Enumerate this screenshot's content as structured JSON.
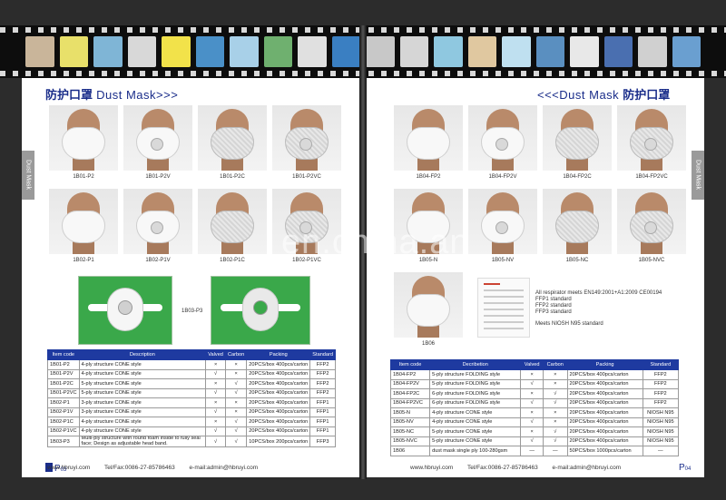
{
  "filmstrip": {
    "frame_colors": [
      "#c9b59a",
      "#e8e06a",
      "#7fb5d6",
      "#d8d8d8",
      "#f2e24a",
      "#4a90c8",
      "#a8d0e8",
      "#6fb06f",
      "#e0e0e0",
      "#3a7fc2",
      "#c8c8c8",
      "#d6d6d6",
      "#8fc8e0",
      "#e0c8a0",
      "#bfe0f0",
      "#5a8fc0",
      "#e8e8e8",
      "#4a6fb0",
      "#d0d0d0",
      "#6a9fd0"
    ]
  },
  "left_page": {
    "title_cn": "防护口罩",
    "title_en": " Dust Mask>>>",
    "side_tab": "Dust Mask",
    "row1_codes": [
      "1B01-P2",
      "1B01-P2V",
      "1B01-P2C",
      "1B01-P2VC"
    ],
    "row2_codes": [
      "1B02-P1",
      "1B02-P1V",
      "1B02-P1C",
      "1B02-P1VC"
    ],
    "wide_label": "1B03-P3",
    "table": {
      "headers": [
        "Item code",
        "Description",
        "Valved",
        "Carbon",
        "Packing",
        "Standard"
      ],
      "rows": [
        [
          "1B01-P2",
          "4-ply structure  CONE style",
          "×",
          "×",
          "20PCS/box 400pcs/carton",
          "FFP2"
        ],
        [
          "1B01-P2V",
          "4-ply structure  CONE style",
          "√",
          "×",
          "20PCS/box 400pcs/carton",
          "FFP2"
        ],
        [
          "1B01-P2C",
          "5-ply structure  CONE style",
          "×",
          "√",
          "20PCS/box 400pcs/carton",
          "FFP2"
        ],
        [
          "1B01-P2VC",
          "5-ply structure  CONE style",
          "√",
          "√",
          "20PCS/box 400pcs/carton",
          "FFP2"
        ],
        [
          "1B02-P1",
          "3-ply structure  CONE style",
          "×",
          "×",
          "20PCS/box 400pcs/carton",
          "FFP1"
        ],
        [
          "1B02-P1V",
          "3-ply structure  CONE style",
          "√",
          "×",
          "20PCS/box 400pcs/carton",
          "FFP1"
        ],
        [
          "1B02-P1C",
          "4-ply structure  CONE style",
          "×",
          "√",
          "20PCS/box 400pcs/carton",
          "FFP1"
        ],
        [
          "1B02-P1VC",
          "4-ply structure  CONE style",
          "√",
          "√",
          "20PCS/box 400pcs/carton",
          "FFP1"
        ],
        [
          "1B03-P3",
          "Multi-ply structure with round foam inside to fully seal face; Design as adjustable head band.",
          "√",
          "√",
          "10PCS/box 200pcs/carton",
          "FFP3"
        ]
      ]
    },
    "page_prefix": "P",
    "page_number": "03",
    "footer": {
      "web": "www.hbruyi.com",
      "tel": "Tel/Fax:0086-27-85786463",
      "email": "e-mail:admin@hbruyi.com"
    }
  },
  "right_page": {
    "title_en": "<<<Dust Mask ",
    "title_cn": "防护口罩",
    "side_tab": "Dust Mask",
    "row1_codes": [
      "1B04-FP2",
      "1B04-FP2V",
      "1B04-FP2C",
      "1B04-FP2VC"
    ],
    "row2_codes": [
      "1B05-N",
      "1B05-NV",
      "1B05-NC",
      "1B05-NVC"
    ],
    "single_code": "1B06",
    "cert_notes": [
      "All respirator meets EN149:2001+A1:2009 CE00194",
      "FFP1  standard",
      "FFP2  standard",
      "FFP3  standard",
      "Meets NIOSH N95 standard"
    ],
    "table": {
      "headers": [
        "Item code",
        "Decribetion",
        "Valved",
        "Carbon",
        "Packing",
        "Standard"
      ],
      "rows": [
        [
          "1B04-FP2",
          "5-ply structure  FOLDING style",
          "×",
          "×",
          "20PCS/box 400pcs/carton",
          "FFP2"
        ],
        [
          "1B04-FP2V",
          "5-ply structure  FOLDING style",
          "√",
          "×",
          "20PCS/box 400pcs/carton",
          "FFP2"
        ],
        [
          "1B04-FP2C",
          "6-ply structure  FOLDING style",
          "×",
          "√",
          "20PCS/box 400pcs/carton",
          "FFP2"
        ],
        [
          "1B04-FP2VC",
          "6-ply structure  FOLDING style",
          "√",
          "√",
          "20PCS/box 400pcs/carton",
          "FFP2"
        ],
        [
          "1B05-N",
          "4-ply structure  CONE style",
          "×",
          "×",
          "20PCS/box 400pcs/carton",
          "NIOSH N95"
        ],
        [
          "1B05-NV",
          "4-ply structure  CONE style",
          "√",
          "×",
          "20PCS/box 400pcs/carton",
          "NIOSH N95"
        ],
        [
          "1B05-NC",
          "5-ply structure  CONE style",
          "×",
          "√",
          "20PCS/box 400pcs/carton",
          "NIOSH N95"
        ],
        [
          "1B05-NVC",
          "5-ply structure  CONE style",
          "√",
          "√",
          "20PCS/box 400pcs/carton",
          "NIOSH N95"
        ],
        [
          "1B06",
          "dust mask single ply 100-280gsm",
          "—",
          "—",
          "50PCS/box 1000pcs/carton",
          "—"
        ]
      ]
    },
    "page_prefix": "P",
    "page_number": "04",
    "footer": {
      "web": "www.hbruyi.com",
      "tel": "Tel/Fax:0086-27-85786463",
      "email": "e-mail:admin@hbruyi.com"
    }
  },
  "watermark": "en.china.an"
}
